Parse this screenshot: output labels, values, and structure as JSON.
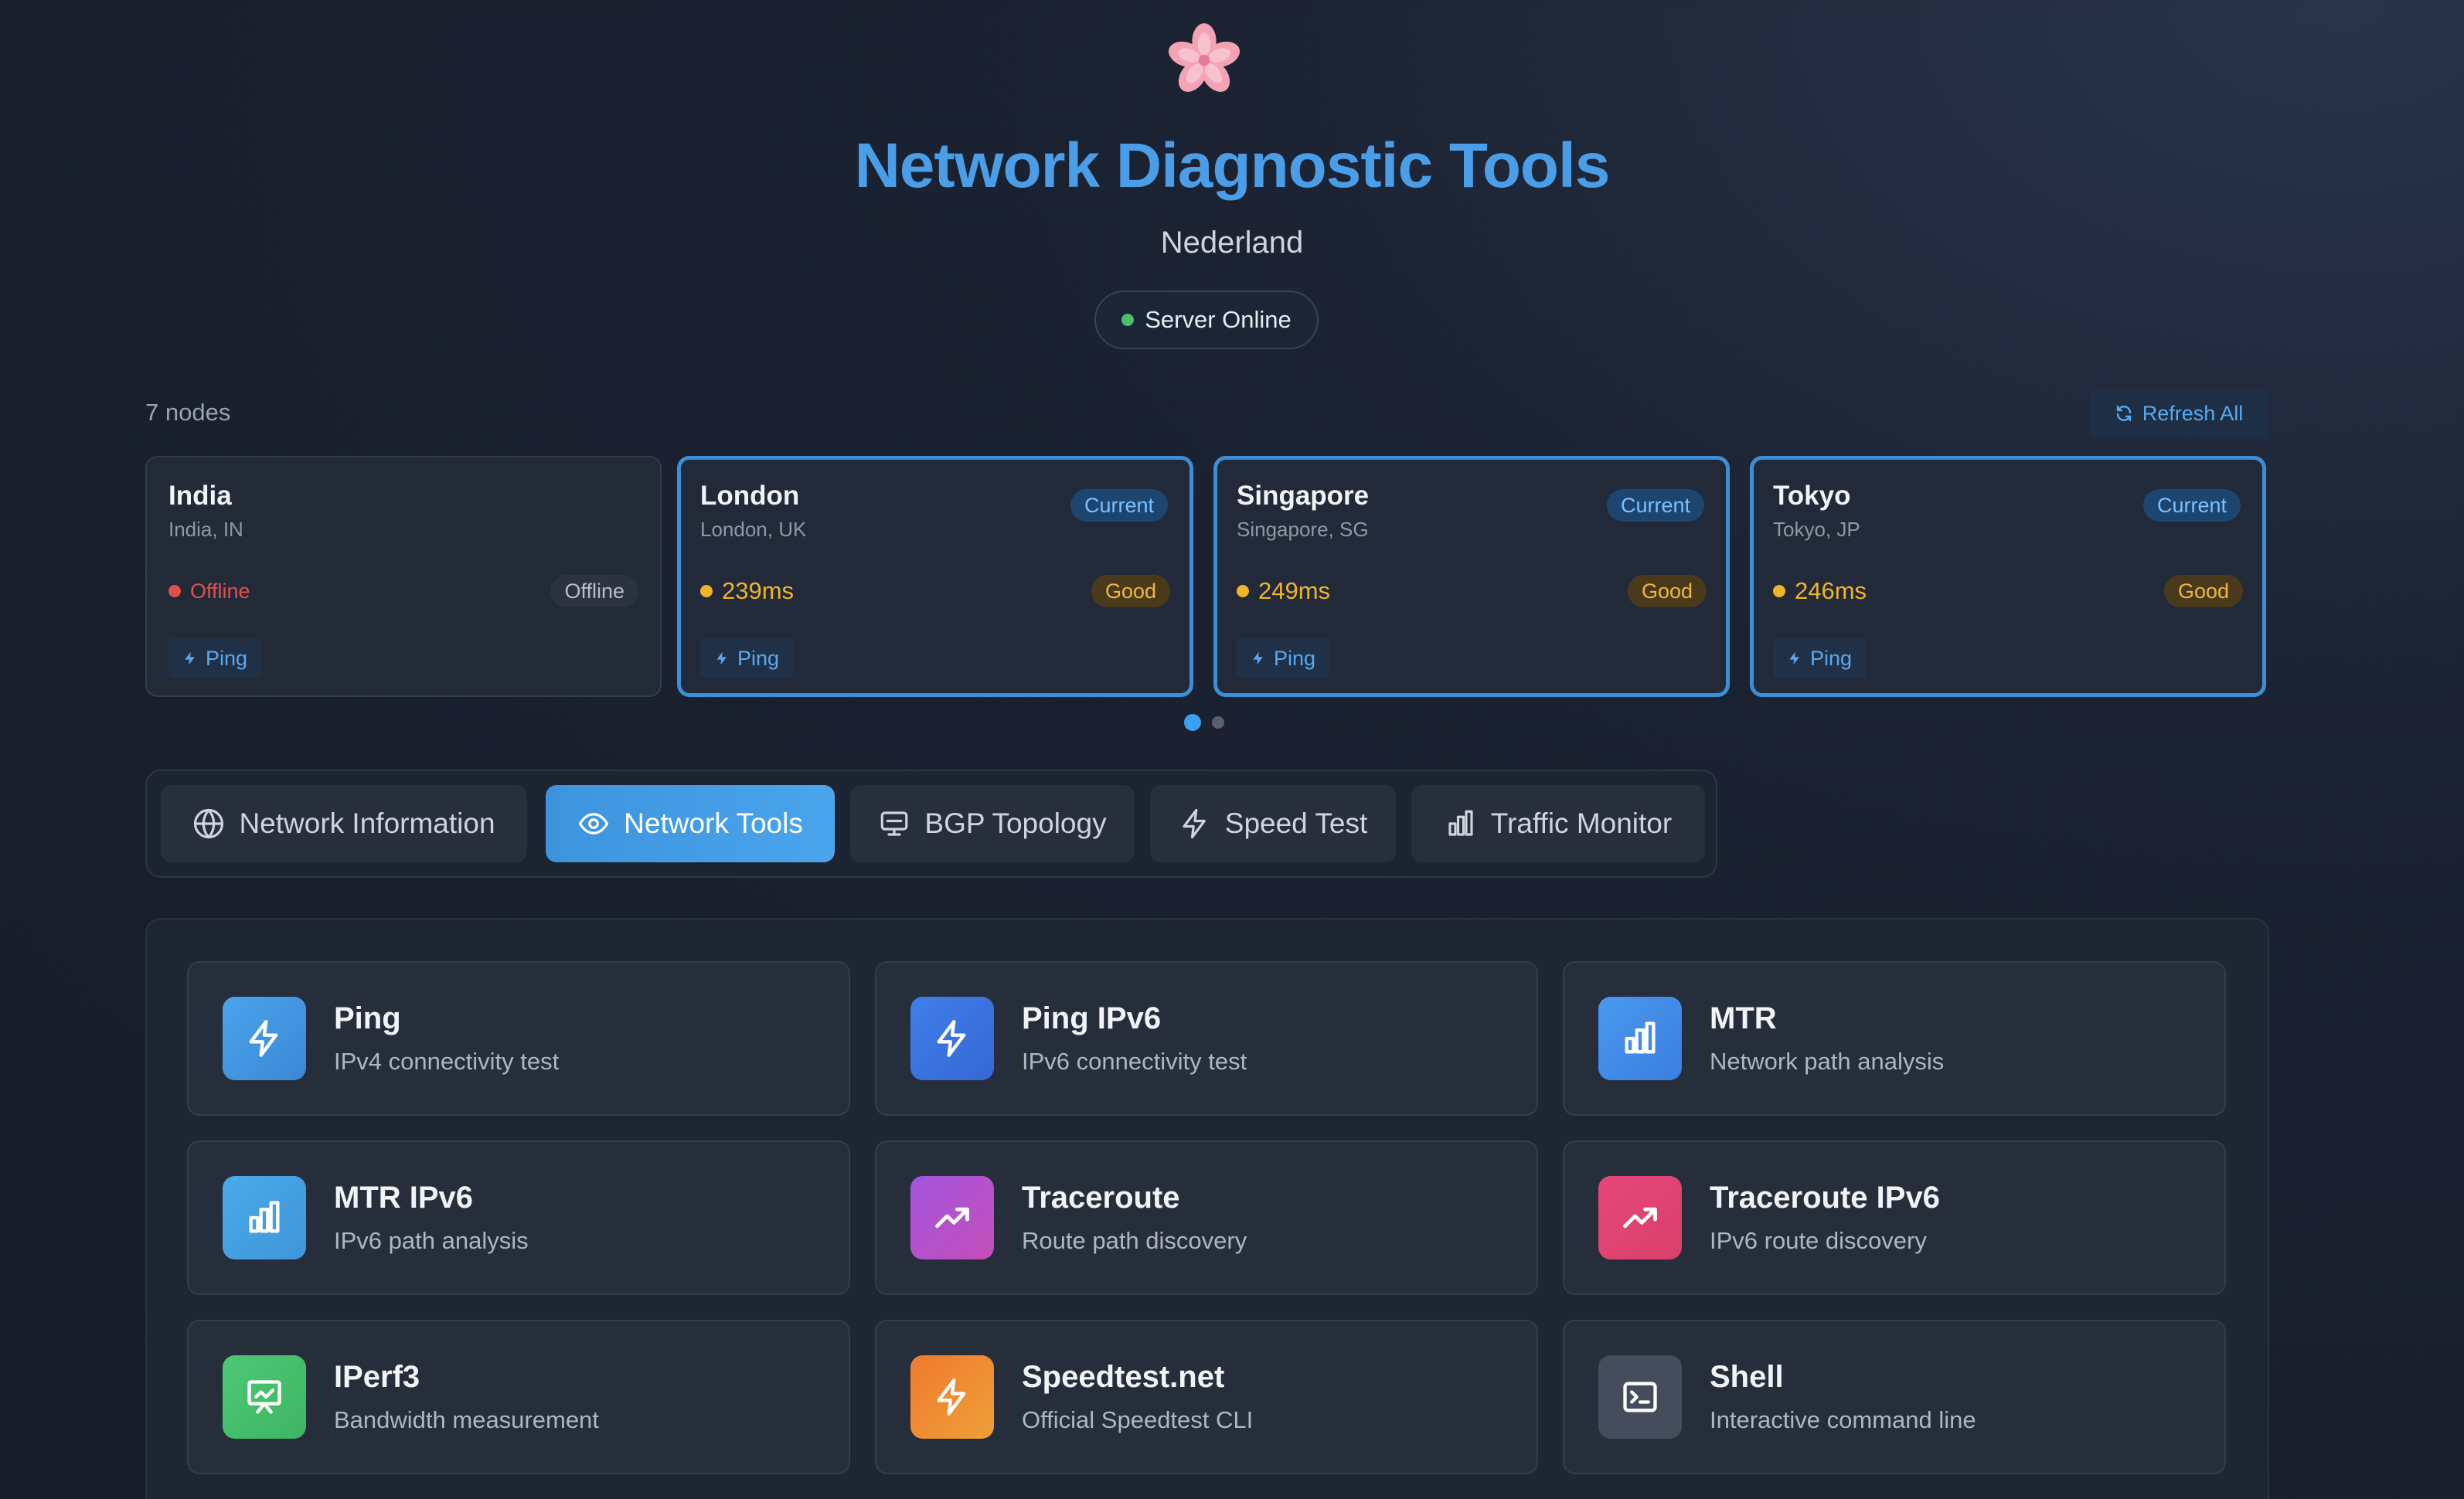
{
  "header": {
    "title": "Network Diagnostic Tools",
    "subtitle": "Nederland",
    "status": "Server Online",
    "logo_icon": "cherry-blossom-icon"
  },
  "nodes": {
    "count_label": "7 nodes",
    "refresh_label": "Refresh All",
    "items": [
      {
        "name": "India",
        "location": "India, IN",
        "status": "Offline",
        "quality": "Offline",
        "current": false,
        "ping_label": "Ping"
      },
      {
        "name": "London",
        "location": "London, UK",
        "latency": "239ms",
        "quality": "Good",
        "current": true,
        "current_label": "Current",
        "ping_label": "Ping"
      },
      {
        "name": "Singapore",
        "location": "Singapore, SG",
        "latency": "249ms",
        "quality": "Good",
        "current": true,
        "current_label": "Current",
        "ping_label": "Ping"
      },
      {
        "name": "Tokyo",
        "location": "Tokyo, JP",
        "latency": "246ms",
        "quality": "Good",
        "current": true,
        "current_label": "Current",
        "ping_label": "Ping"
      }
    ],
    "pager": {
      "pages": 2,
      "active": 1
    }
  },
  "tabs": [
    {
      "label": "Network Information",
      "icon": "globe-icon",
      "active": false
    },
    {
      "label": "Network Tools",
      "icon": "eye-icon",
      "active": true
    },
    {
      "label": "BGP Topology",
      "icon": "monitor-icon",
      "active": false
    },
    {
      "label": "Speed Test",
      "icon": "lightning-icon",
      "active": false
    },
    {
      "label": "Traffic Monitor",
      "icon": "bar-chart-icon",
      "active": false
    }
  ],
  "tools": [
    {
      "name": "Ping",
      "desc": "IPv4 connectivity test",
      "icon": "lightning-icon"
    },
    {
      "name": "Ping IPv6",
      "desc": "IPv6 connectivity test",
      "icon": "lightning-icon"
    },
    {
      "name": "MTR",
      "desc": "Network path analysis",
      "icon": "bar-chart-icon"
    },
    {
      "name": "MTR IPv6",
      "desc": "IPv6 path analysis",
      "icon": "bar-chart-icon"
    },
    {
      "name": "Traceroute",
      "desc": "Route path discovery",
      "icon": "trending-up-icon"
    },
    {
      "name": "Traceroute IPv6",
      "desc": "IPv6 route discovery",
      "icon": "trending-up-icon"
    },
    {
      "name": "IPerf3",
      "desc": "Bandwidth measurement",
      "icon": "presentation-chart-icon"
    },
    {
      "name": "Speedtest.net",
      "desc": "Official Speedtest CLI",
      "icon": "lightning-icon"
    },
    {
      "name": "Shell",
      "desc": "Interactive command line",
      "icon": "terminal-icon"
    }
  ],
  "colors": {
    "accent": "#4a9ee8",
    "online": "#4cc06a",
    "offline": "#e0504c",
    "latency_warn": "#f0b429",
    "good_badge_bg": "#4a3a1c",
    "good_badge_text": "#f0b73c"
  }
}
